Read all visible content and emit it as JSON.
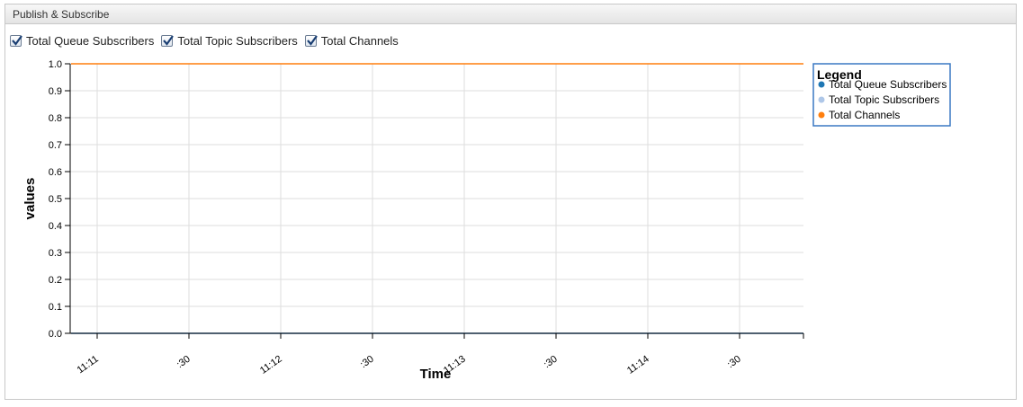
{
  "panel": {
    "title": "Publish & Subscribe"
  },
  "toggles": [
    {
      "label": "Total Queue Subscribers",
      "checked": true
    },
    {
      "label": "Total Topic Subscribers",
      "checked": true
    },
    {
      "label": "Total Channels",
      "checked": true
    }
  ],
  "chart_data": {
    "type": "line",
    "xlabel": "Time",
    "ylabel": "values",
    "ylim": [
      0,
      1.0
    ],
    "y_ticks": [
      "0.0",
      "0.1",
      "0.2",
      "0.3",
      "0.4",
      "0.5",
      "0.6",
      "0.7",
      "0.8",
      "0.9",
      "1.0"
    ],
    "x_ticks": [
      "11:11",
      ":30",
      "11:12",
      ":30",
      "11:13",
      ":30",
      "11:14",
      ":30"
    ],
    "grid": true,
    "legend": {
      "title": "Legend",
      "placement": "top-right"
    },
    "series": [
      {
        "name": "Total Queue Subscribers",
        "color": "#1f77b4",
        "values": [
          0,
          0,
          0,
          0,
          0,
          0,
          0,
          0,
          0
        ]
      },
      {
        "name": "Total Topic Subscribers",
        "color": "#aec7e8",
        "values": [
          0,
          0,
          0,
          0,
          0,
          0,
          0,
          0,
          0
        ]
      },
      {
        "name": "Total Channels",
        "color": "#ff7f0e",
        "values": [
          1,
          1,
          1,
          1,
          1,
          1,
          1,
          1,
          1
        ]
      }
    ]
  }
}
